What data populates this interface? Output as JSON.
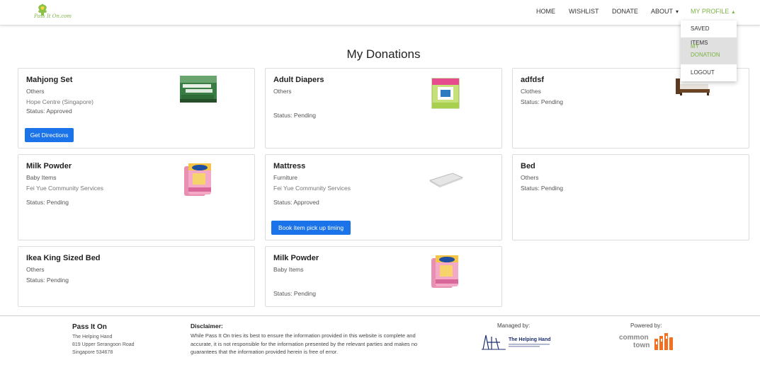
{
  "header": {
    "logo_alt": "Pass It On logo",
    "logo_text": "Pass It On.com",
    "nav": {
      "home": "HOME",
      "wishlist": "WISHLIST",
      "donate": "DONATE",
      "about": "ABOUT",
      "my_profile": "MY PROFILE"
    },
    "dropdown": {
      "saved_items": "SAVED ITEMS",
      "my_donation_1": "MY",
      "my_donation_2": "DONATION",
      "logout": "LOGOUT"
    }
  },
  "page_title": "My Donations",
  "cards": [
    {
      "name": "Mahjong Set",
      "category": "Others",
      "org": "Hope Centre (Singapore)",
      "status": "Status: Approved",
      "button": "Get Directions"
    },
    {
      "name": "Adult Diapers",
      "category": "Others",
      "org": "",
      "status": "Status: Pending",
      "button": ""
    },
    {
      "name": "adfdsf",
      "category": "Clothes",
      "org": "",
      "status": "Status: Pending",
      "button": ""
    },
    {
      "name": "Milk Powder",
      "category": "Baby Items",
      "org": "Fei Yue Community Services",
      "status": "Status: Pending",
      "button": ""
    },
    {
      "name": "Mattress",
      "category": "Furniture",
      "org": "Fei Yue Community Services",
      "status": "Status: Approved",
      "button": "Book item pick up timing"
    },
    {
      "name": "Bed",
      "category": "Others",
      "org": "",
      "status": "Status: Pending",
      "button": ""
    },
    {
      "name": "Ikea King Sized Bed",
      "category": "Others",
      "org": "",
      "status": "Status: Pending",
      "button": ""
    },
    {
      "name": "Milk Powder",
      "category": "Baby Items",
      "org": "",
      "status": "Status: Pending",
      "button": ""
    }
  ],
  "footer": {
    "brand": "Pass It On",
    "address": [
      "The Helping Hand",
      "819 Upper Serangoon Road",
      "Singapore 534678"
    ],
    "disclaimer_title": "Disclaimer:",
    "disclaimer_text": "While Pass It On tries its best to ensure the information provided in this website is complete and accurate, it is not responsible for the information presented by the relevant parties and makes no guarantees that the information provided herein is free of error.",
    "managed_by": "Managed by:",
    "managed_logo_text": "The Helping Hand",
    "powered_by": "Powered by:",
    "powered_logo_text_1": "common",
    "powered_logo_text_2": "town"
  },
  "colors": {
    "accent_green": "#7cb342",
    "button_blue": "#1a73e8",
    "dropdown_hover": "#e0e0e0",
    "logo_orange": "#f36f21"
  }
}
